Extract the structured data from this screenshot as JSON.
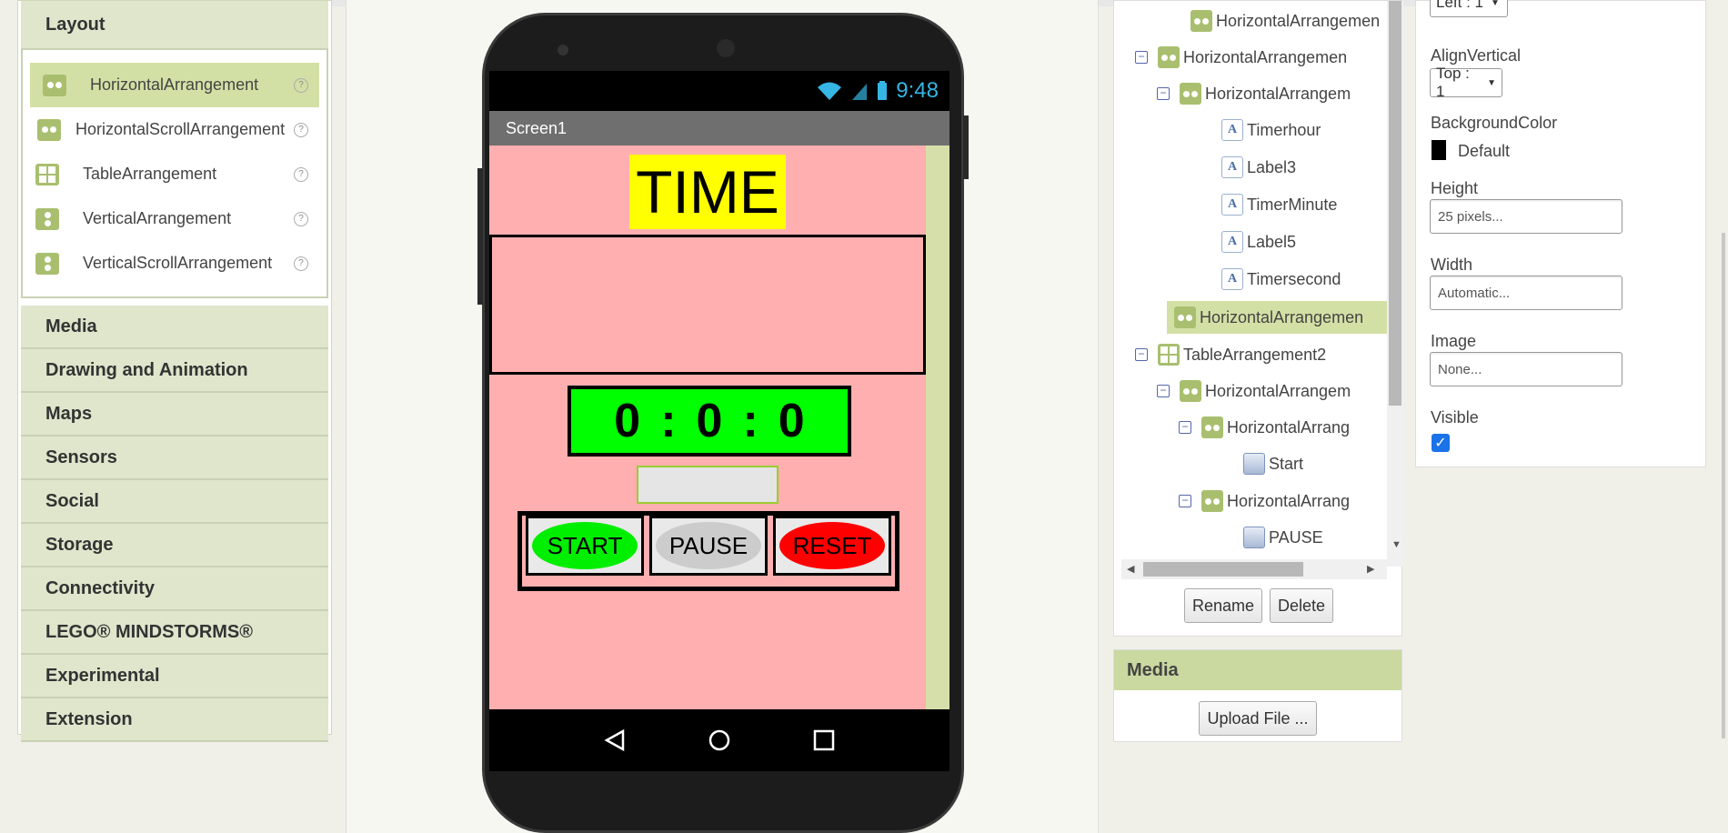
{
  "palette": {
    "layout_header": "Layout",
    "layout_items": [
      {
        "label": "HorizontalArrangement",
        "icon": "horizontal-arrangement-icon",
        "selected": true
      },
      {
        "label": "HorizontalScrollArrangement",
        "icon": "horizontal-scroll-arrangement-icon"
      },
      {
        "label": "TableArrangement",
        "icon": "table-arrangement-icon"
      },
      {
        "label": "VerticalArrangement",
        "icon": "vertical-arrangement-icon"
      },
      {
        "label": "VerticalScrollArrangement",
        "icon": "vertical-scroll-arrangement-icon"
      }
    ],
    "help": "?",
    "categories": [
      "Media",
      "Drawing and Animation",
      "Maps",
      "Sensors",
      "Social",
      "Storage",
      "Connectivity",
      "LEGO® MINDSTORMS®",
      "Experimental",
      "Extension"
    ]
  },
  "viewer": {
    "clock_time": "9:48",
    "screen_title": "Screen1",
    "time_label": "TIME",
    "timer": {
      "hours": "0",
      "sep1": ":",
      "minutes": "0",
      "sep2": ":",
      "seconds": "0"
    },
    "buttons": {
      "start": "START",
      "pause": "PAUSE",
      "reset": "RESET"
    },
    "colors": {
      "screen_bg": "#ffafaf",
      "time_bg": "#ffff00",
      "timer_bg": "#00ff00",
      "start": "#00ee00",
      "pause": "#cccccc",
      "reset": "#ff0000"
    }
  },
  "components": {
    "tree": [
      {
        "label": "HorizontalArrangemen",
        "icon": "ha",
        "toggle": ""
      },
      {
        "label": "HorizontalArrangemen",
        "icon": "ha",
        "toggle": "⊟"
      },
      {
        "label": "HorizontalArrangem",
        "icon": "ha",
        "toggle": "⊟"
      },
      {
        "label": "Timerhour",
        "icon": "lbl"
      },
      {
        "label": "Label3",
        "icon": "lbl"
      },
      {
        "label": "TimerMinute",
        "icon": "lbl"
      },
      {
        "label": "Label5",
        "icon": "lbl"
      },
      {
        "label": "Timersecond",
        "icon": "lbl"
      },
      {
        "label": "HorizontalArrangemen",
        "icon": "ha",
        "selected": true
      },
      {
        "label": "TableArrangement2",
        "icon": "tab",
        "toggle": "⊟"
      },
      {
        "label": "HorizontalArrangem",
        "icon": "ha",
        "toggle": "⊟"
      },
      {
        "label": "HorizontalArrang",
        "icon": "ha",
        "toggle": "⊟"
      },
      {
        "label": "Start",
        "icon": "btn"
      },
      {
        "label": "HorizontalArrang",
        "icon": "ha",
        "toggle": "⊟"
      },
      {
        "label": "PAUSE",
        "icon": "btn"
      }
    ],
    "rename_label": "Rename",
    "delete_label": "Delete"
  },
  "media": {
    "title": "Media",
    "upload_label": "Upload File ..."
  },
  "properties": {
    "align_horizontal_value": "Left : 1",
    "align_vertical_label": "AlignVertical",
    "align_vertical_value": "Top : 1",
    "background_color_label": "BackgroundColor",
    "background_color_value": "Default",
    "height_label": "Height",
    "height_value": "25 pixels...",
    "width_label": "Width",
    "width_value": "Automatic...",
    "image_label": "Image",
    "image_value": "None...",
    "visible_label": "Visible",
    "visible_checked": true
  }
}
